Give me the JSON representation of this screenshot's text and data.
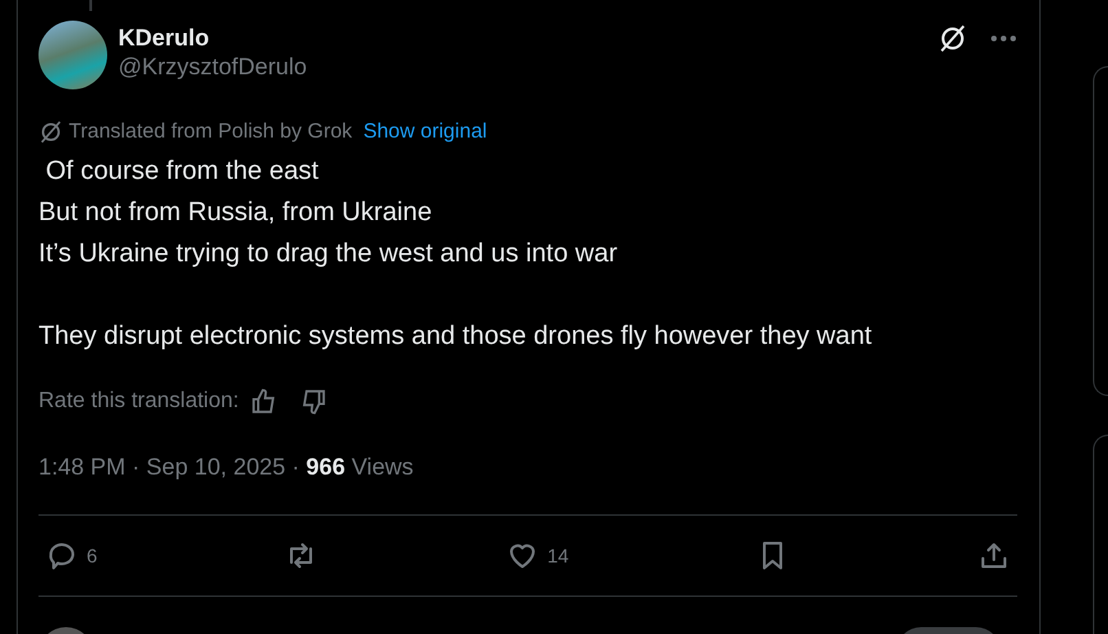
{
  "author": {
    "name": "KDerulo",
    "handle": "@KrzysztofDerulo"
  },
  "translation": {
    "note": "Translated from Polish by Grok",
    "link": "Show original"
  },
  "body_paragraphs": [
    [
      " Of course from the east",
      "But not from Russia, from Ukraine",
      "It’s Ukraine trying to drag the west and us into war"
    ],
    [
      "They disrupt electronic systems and those drones fly however they want"
    ]
  ],
  "rate_label": "Rate this translation:",
  "meta": "1:48 PM · Sep 10, 2025 · **966** Views",
  "actions": [
    {
      "kind": "reply",
      "count": "6"
    },
    {
      "kind": "repost"
    },
    {
      "kind": "like",
      "count": "14"
    },
    {
      "kind": "bookmark"
    },
    {
      "kind": "share"
    }
  ]
}
